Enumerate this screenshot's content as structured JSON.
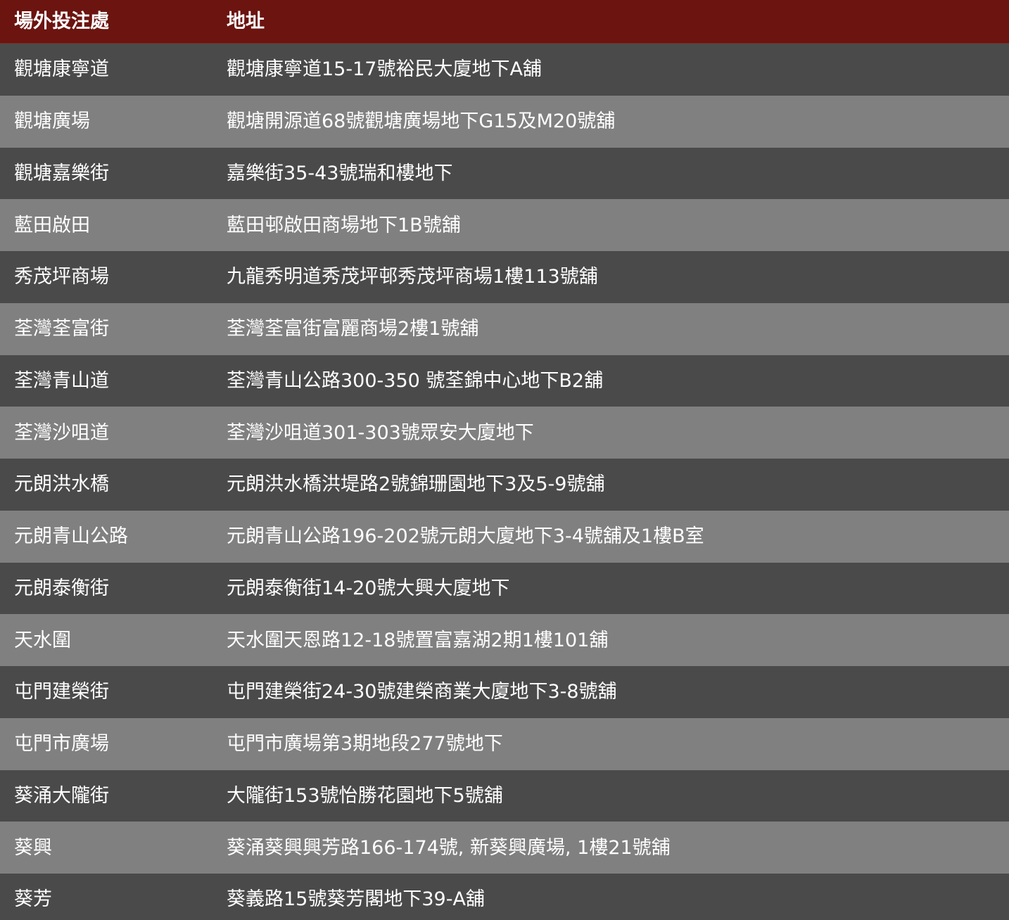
{
  "header": {
    "col_name": "場外投注處",
    "col_address": "地址"
  },
  "rows": [
    {
      "name": "觀塘康寧道",
      "address": "觀塘康寧道15-17號裕民大廈地下A舖"
    },
    {
      "name": "觀塘廣場",
      "address": "觀塘開源道68號觀塘廣場地下G15及M20號舖"
    },
    {
      "name": "觀塘嘉樂街",
      "address": "嘉樂街35-43號瑞和樓地下"
    },
    {
      "name": "藍田啟田",
      "address": "藍田邨啟田商場地下1B號舖"
    },
    {
      "name": "秀茂坪商場",
      "address": "九龍秀明道秀茂坪邨秀茂坪商場1樓113號舖"
    },
    {
      "name": "荃灣荃富街",
      "address": "荃灣荃富街富麗商場2樓1號舖"
    },
    {
      "name": "荃灣青山道",
      "address": "荃灣青山公路300-350 號荃錦中心地下B2舖"
    },
    {
      "name": "荃灣沙咀道",
      "address": "荃灣沙咀道301-303號眾安大廈地下"
    },
    {
      "name": "元朗洪水橋",
      "address": "元朗洪水橋洪堤路2號錦珊園地下3及5-9號舖"
    },
    {
      "name": "元朗青山公路",
      "address": "元朗青山公路196-202號元朗大廈地下3-4號舖及1樓B室"
    },
    {
      "name": "元朗泰衡街",
      "address": "元朗泰衡街14-20號大興大廈地下"
    },
    {
      "name": "天水圍",
      "address": "天水圍天恩路12-18號置富嘉湖2期1樓101舖"
    },
    {
      "name": "屯門建榮街",
      "address": "屯門建榮街24-30號建榮商業大廈地下3-8號舖"
    },
    {
      "name": "屯門市廣場",
      "address": "屯門市廣場第3期地段277號地下"
    },
    {
      "name": "葵涌大隴街",
      "address": "大隴街153號怡勝花園地下5號舖"
    },
    {
      "name": "葵興",
      "address": "葵涌葵興興芳路166-174號, 新葵興廣場, 1樓21號舖"
    },
    {
      "name": "葵芳",
      "address": "葵義路15號葵芳閣地下39-A舖"
    }
  ]
}
